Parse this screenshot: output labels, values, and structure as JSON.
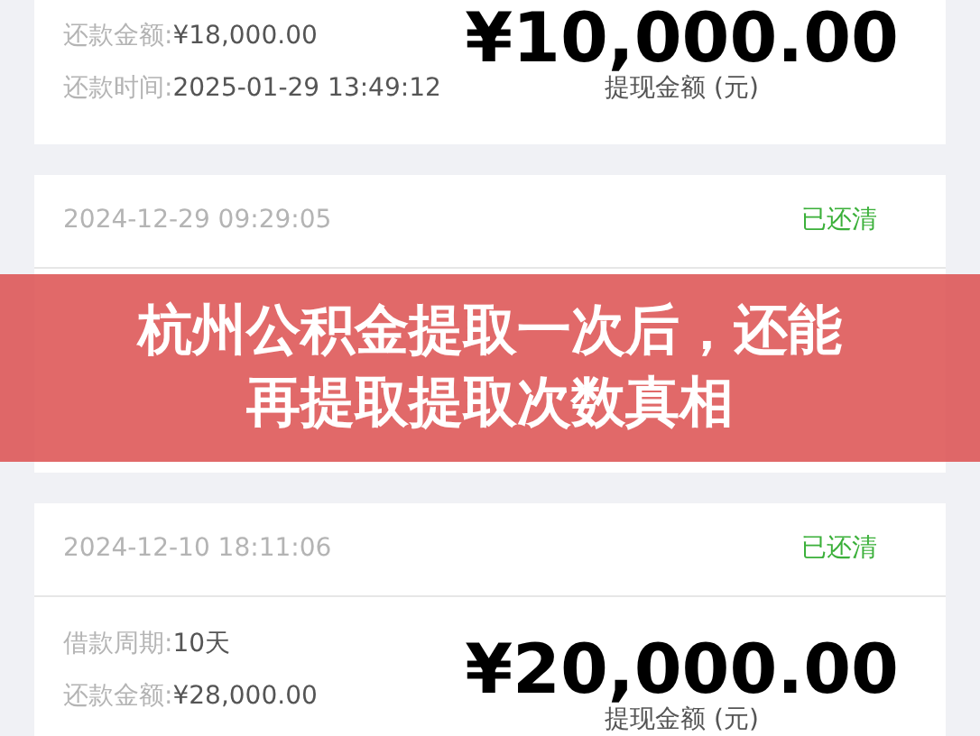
{
  "cards": [
    {
      "rows": [
        {
          "label": "还款金额:",
          "value": "¥18,000.00"
        },
        {
          "label": "还款时间:",
          "value": "2025-01-29 13:49:12"
        }
      ],
      "amount": "¥10,000.00",
      "amount_label": "提现金额 (元)"
    },
    {
      "date": "2024-12-29 09:29:05",
      "status": "已还清"
    },
    {
      "date": "2024-12-10 18:11:06",
      "status": "已还清",
      "rows": [
        {
          "label": "借款周期:",
          "value": "10天"
        },
        {
          "label": "还款金额:",
          "value": "¥28,000.00"
        }
      ],
      "amount": "¥20,000.00",
      "amount_label": "提现金额 (元)"
    }
  ],
  "banner": {
    "lines": [
      "杭州公积金提取一次后，还能",
      "再提取提取次数真相"
    ]
  }
}
